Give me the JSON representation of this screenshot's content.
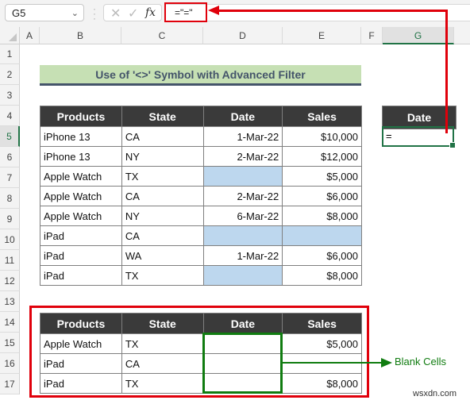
{
  "formula_bar": {
    "name_box": "G5",
    "name_box_chevron": "⌄",
    "cancel_icon": "✕",
    "enter_icon": "✓",
    "fx_label": "fx",
    "formula": "=\"=\""
  },
  "columns": [
    "A",
    "B",
    "C",
    "D",
    "E",
    "F",
    "G"
  ],
  "rows": [
    "1",
    "2",
    "3",
    "4",
    "5",
    "6",
    "7",
    "8",
    "9",
    "10",
    "11",
    "12",
    "13",
    "14",
    "15",
    "16",
    "17"
  ],
  "selected_cell": {
    "column": "G",
    "row": "5"
  },
  "title": "Use of '<>'  Symbol with Advanced Filter",
  "main_table": {
    "headers": [
      "Products",
      "State",
      "Date",
      "Sales"
    ],
    "rows": [
      {
        "product": "iPhone 13",
        "state": "CA",
        "date": "1-Mar-22",
        "sales": "$10,000"
      },
      {
        "product": "iPhone 13",
        "state": "NY",
        "date": "2-Mar-22",
        "sales": "$12,000"
      },
      {
        "product": "Apple Watch",
        "state": "TX",
        "date": "",
        "sales": "$5,000"
      },
      {
        "product": "Apple Watch",
        "state": "CA",
        "date": "2-Mar-22",
        "sales": "$6,000"
      },
      {
        "product": "Apple Watch",
        "state": "NY",
        "date": "6-Mar-22",
        "sales": "$8,000"
      },
      {
        "product": "iPad",
        "state": "CA",
        "date": "",
        "sales": ""
      },
      {
        "product": "iPad",
        "state": "WA",
        "date": "1-Mar-22",
        "sales": "$6,000"
      },
      {
        "product": "iPad",
        "state": "TX",
        "date": "",
        "sales": "$8,000"
      }
    ]
  },
  "criteria": {
    "header": "Date",
    "value": "="
  },
  "result_table": {
    "headers": [
      "Products",
      "State",
      "Date",
      "Sales"
    ],
    "rows": [
      {
        "product": "Apple Watch",
        "state": "TX",
        "date": "",
        "sales": "$5,000"
      },
      {
        "product": "iPad",
        "state": "CA",
        "date": "",
        "sales": ""
      },
      {
        "product": "iPad",
        "state": "TX",
        "date": "",
        "sales": "$8,000"
      }
    ]
  },
  "annotation": {
    "blank_cells_label": "Blank Cells"
  },
  "colors": {
    "highlight_red": "#e0000b",
    "annotation_green": "#107c10",
    "blank_fill": "#bdd7ee",
    "header_fill": "#3a3a3a",
    "title_fill": "#c6e0b4"
  },
  "watermark": "wsxdn.com"
}
